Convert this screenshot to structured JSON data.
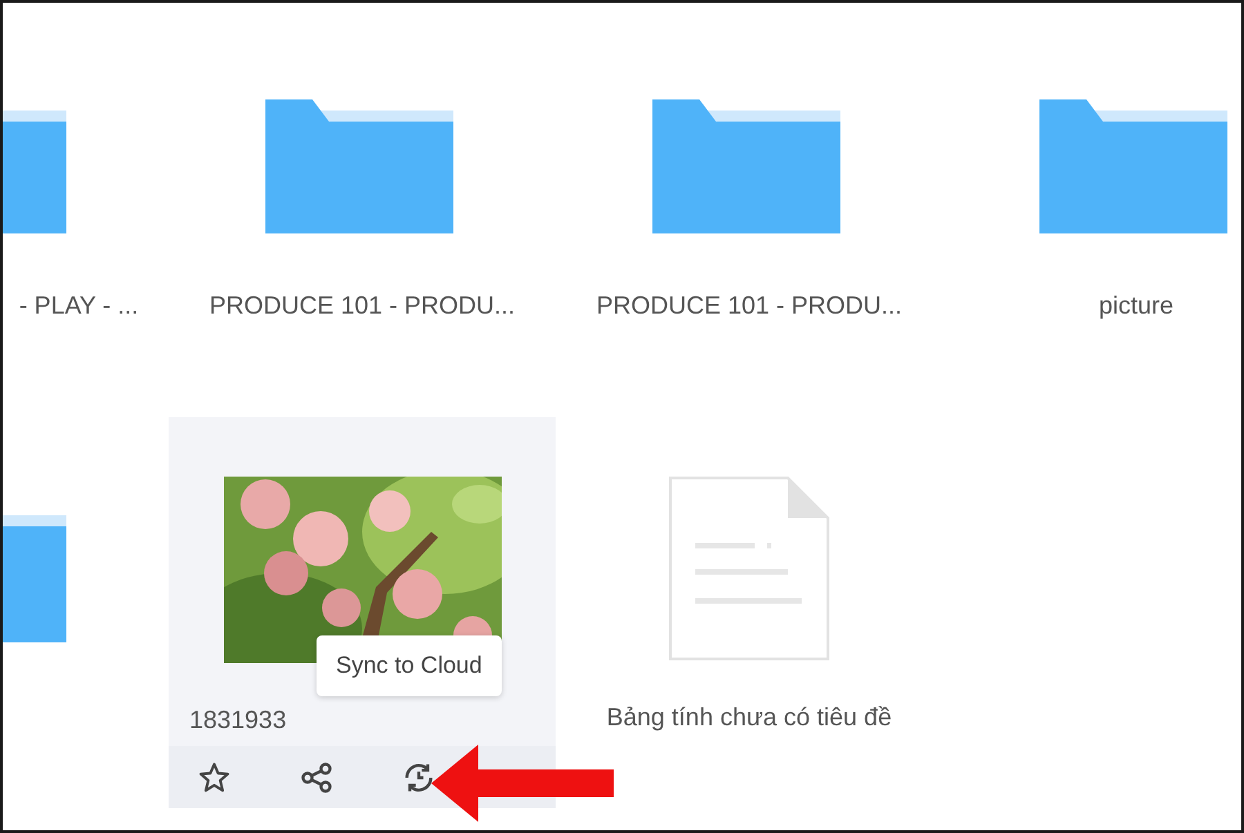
{
  "rows": [
    {
      "items": [
        {
          "kind": "folder",
          "name": "- PLAY - ...",
          "selected": false
        },
        {
          "kind": "folder",
          "name": "PRODUCE 101 - PRODU...",
          "selected": false
        },
        {
          "kind": "folder",
          "name": "PRODUCE 101 - PRODU...",
          "selected": false
        },
        {
          "kind": "folder",
          "name": "picture",
          "selected": false
        }
      ]
    },
    {
      "items": [
        {
          "kind": "folder",
          "selected": false
        },
        {
          "name": "1831933",
          "selected": true,
          "tooltip": "Sync to Cloud"
        },
        {
          "kind": "document",
          "name": "Bảng tính chưa có tiêu đề",
          "selected": false
        }
      ]
    }
  ]
}
